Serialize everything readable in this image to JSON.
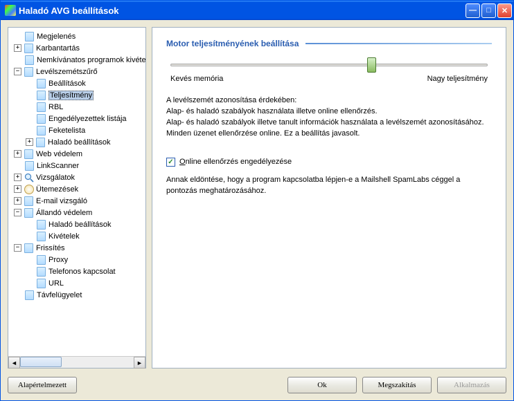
{
  "window": {
    "title": "Haladó AVG beállítások"
  },
  "titlebar_buttons": {
    "min": "_",
    "max": "□",
    "close": "X"
  },
  "tree": [
    {
      "level": 0,
      "expander": null,
      "icon": "page",
      "label": "Megjelenés"
    },
    {
      "level": 0,
      "expander": "+",
      "icon": "page",
      "label": "Karbantartás"
    },
    {
      "level": 0,
      "expander": null,
      "icon": "page",
      "label": "Nemkívánatos programok kivételei"
    },
    {
      "level": 0,
      "expander": "-",
      "icon": "page",
      "label": "Levélszemétszűrő"
    },
    {
      "level": 1,
      "expander": null,
      "icon": "page",
      "label": "Beállítások"
    },
    {
      "level": 1,
      "expander": null,
      "icon": "page",
      "label": "Teljesítmény",
      "selected": true
    },
    {
      "level": 1,
      "expander": null,
      "icon": "page",
      "label": "RBL"
    },
    {
      "level": 1,
      "expander": null,
      "icon": "page",
      "label": "Engedélyezettek listája"
    },
    {
      "level": 1,
      "expander": null,
      "icon": "page",
      "label": "Feketelista"
    },
    {
      "level": 1,
      "expander": "+",
      "icon": "page",
      "label": "Haladó beállítások"
    },
    {
      "level": 0,
      "expander": "+",
      "icon": "page",
      "label": "Web védelem"
    },
    {
      "level": 0,
      "expander": null,
      "icon": "page",
      "label": "LinkScanner"
    },
    {
      "level": 0,
      "expander": "+",
      "icon": "mag",
      "label": "Vizsgálatok"
    },
    {
      "level": 0,
      "expander": "+",
      "icon": "clock",
      "label": "Ütemezések"
    },
    {
      "level": 0,
      "expander": "+",
      "icon": "page",
      "label": "E-mail vizsgáló"
    },
    {
      "level": 0,
      "expander": "-",
      "icon": "page",
      "label": "Állandó védelem"
    },
    {
      "level": 1,
      "expander": null,
      "icon": "page",
      "label": "Haladó beállítások"
    },
    {
      "level": 1,
      "expander": null,
      "icon": "page",
      "label": "Kivételek"
    },
    {
      "level": 0,
      "expander": "-",
      "icon": "page",
      "label": "Frissítés"
    },
    {
      "level": 1,
      "expander": null,
      "icon": "page",
      "label": "Proxy"
    },
    {
      "level": 1,
      "expander": null,
      "icon": "page",
      "label": "Telefonos kapcsolat"
    },
    {
      "level": 1,
      "expander": null,
      "icon": "page",
      "label": "URL"
    },
    {
      "level": 0,
      "expander": null,
      "icon": "page",
      "label": "Távfelügyelet"
    }
  ],
  "content": {
    "heading": "Motor teljesítményének beállítása",
    "slider": {
      "left_label": "Kevés memória",
      "right_label": "Nagy teljesítmény",
      "position_percent": 62
    },
    "description_lines": [
      "A levélszemét azonosítása érdekében:",
      "Alap- és haladó szabályok használata illetve online ellenőrzés.",
      "Alap- és haladó szabályok illetve tanult információk használata a levélszemét azonosításához.",
      "Minden üzenet ellenőrzése online. Ez a beállítás javasolt."
    ],
    "checkbox": {
      "checked": true,
      "label_pre": "",
      "label_underlined": "O",
      "label_rest": "nline ellenőrzés engedélyezése"
    },
    "sub_description": "Annak eldöntése, hogy a program kapcsolatba lépjen-e a Mailshell SpamLabs céggel a pontozás meghatározásához."
  },
  "buttons": {
    "default": "Alapértelmezett",
    "ok": "Ok",
    "cancel": "Megszakítás",
    "apply": "Alkalmazás"
  }
}
